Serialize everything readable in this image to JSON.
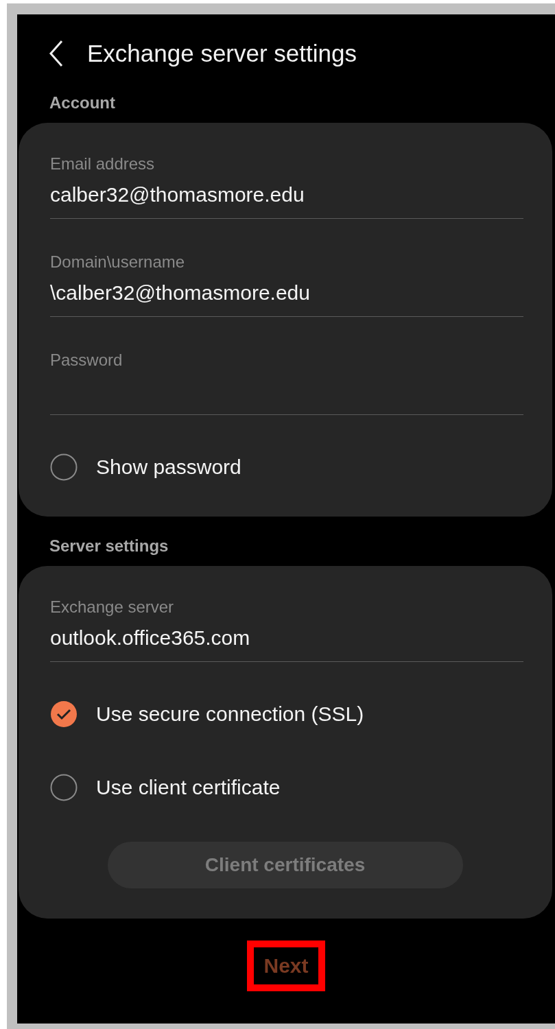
{
  "header": {
    "title": "Exchange server settings"
  },
  "sections": [
    {
      "title": "Account",
      "items": [
        {
          "kind": "field",
          "label": "Email address",
          "value": "calber32@thomasmore.edu"
        },
        {
          "kind": "field",
          "label": "Domain\\username",
          "value": "\\calber32@thomasmore.edu"
        },
        {
          "kind": "field",
          "label": "Password"
        },
        {
          "kind": "checkbox",
          "label": "Show password",
          "checked": false
        }
      ]
    },
    {
      "title": "Server settings",
      "items": [
        {
          "kind": "field",
          "label": "Exchange server",
          "value": "outlook.office365.com"
        },
        {
          "kind": "checkbox",
          "label": "Use secure connection (SSL)",
          "checked": true
        },
        {
          "kind": "checkbox",
          "label": "Use client certificate",
          "checked": false
        },
        {
          "kind": "button",
          "label": "Client certificates",
          "disabled": true
        }
      ]
    }
  ],
  "next_button": {
    "label": "Next",
    "disabled": true,
    "highlighted": true
  }
}
